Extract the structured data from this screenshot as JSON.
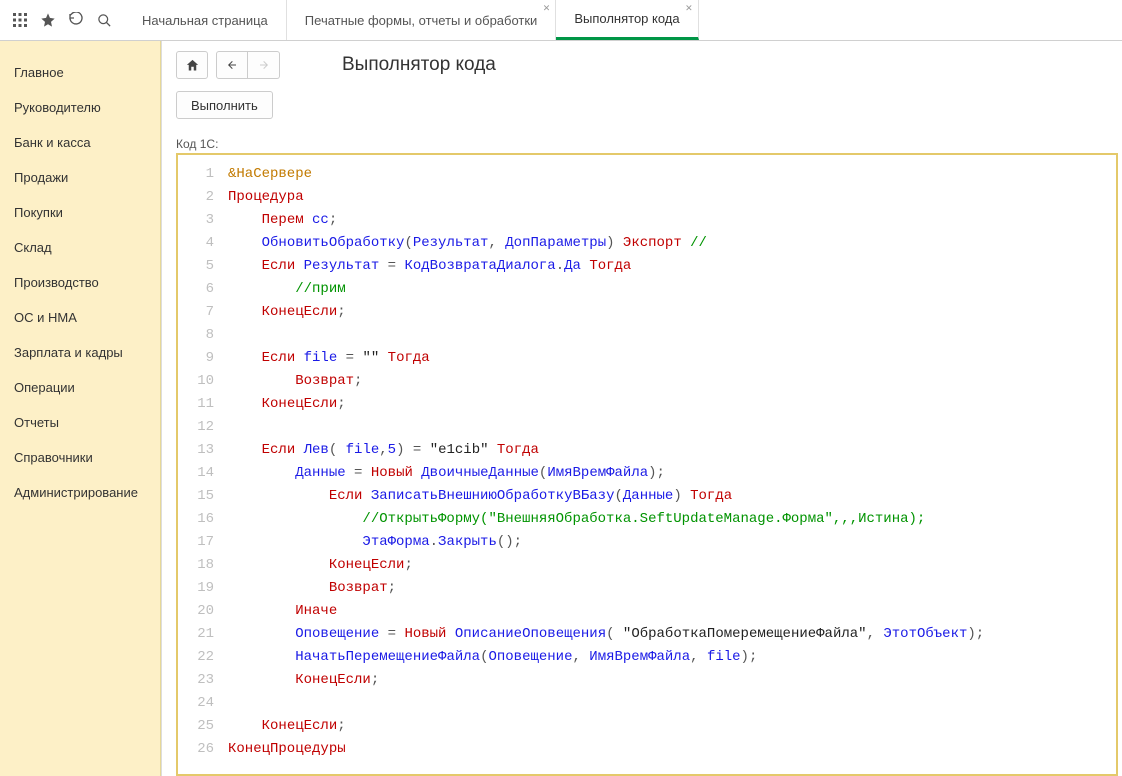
{
  "tabs": [
    {
      "label": "Начальная страница",
      "closable": false,
      "active": false
    },
    {
      "label": "Печатные формы, отчеты и обработки",
      "closable": true,
      "active": false
    },
    {
      "label": "Выполнятор кода",
      "closable": true,
      "active": true
    }
  ],
  "sidebar": {
    "items": [
      "Главное",
      "Руководителю",
      "Банк и касса",
      "Продажи",
      "Покупки",
      "Склад",
      "Производство",
      "ОС и НМА",
      "Зарплата и кадры",
      "Операции",
      "Отчеты",
      "Справочники",
      "Администрирование"
    ]
  },
  "page": {
    "title": "Выполнятор кода",
    "execute_button": "Выполнить",
    "code_label": "Код 1С:"
  },
  "code_lines": [
    [
      {
        "c": "dir",
        "t": "&НаСервере"
      }
    ],
    [
      {
        "c": "kw",
        "t": "Процедура"
      }
    ],
    [
      {
        "c": "pn",
        "t": "    "
      },
      {
        "c": "kw",
        "t": "Перем"
      },
      {
        "c": "pn",
        "t": " "
      },
      {
        "c": "id",
        "t": "сс"
      },
      {
        "c": "pn",
        "t": ";"
      }
    ],
    [
      {
        "c": "pn",
        "t": "    "
      },
      {
        "c": "id",
        "t": "ОбновитьОбработку"
      },
      {
        "c": "pn",
        "t": "("
      },
      {
        "c": "id",
        "t": "Результат"
      },
      {
        "c": "pn",
        "t": ", "
      },
      {
        "c": "id",
        "t": "ДопПараметры"
      },
      {
        "c": "pn",
        "t": ") "
      },
      {
        "c": "kw",
        "t": "Экспорт"
      },
      {
        "c": "pn",
        "t": " "
      },
      {
        "c": "cm",
        "t": "//"
      }
    ],
    [
      {
        "c": "pn",
        "t": "    "
      },
      {
        "c": "kw",
        "t": "Если"
      },
      {
        "c": "pn",
        "t": " "
      },
      {
        "c": "id",
        "t": "Результат"
      },
      {
        "c": "pn",
        "t": " = "
      },
      {
        "c": "id",
        "t": "КодВозвратаДиалога"
      },
      {
        "c": "pn",
        "t": "."
      },
      {
        "c": "id",
        "t": "Да"
      },
      {
        "c": "pn",
        "t": " "
      },
      {
        "c": "kw",
        "t": "Тогда"
      }
    ],
    [
      {
        "c": "pn",
        "t": "        "
      },
      {
        "c": "cm",
        "t": "//прим"
      }
    ],
    [
      {
        "c": "pn",
        "t": "    "
      },
      {
        "c": "kw",
        "t": "КонецЕсли"
      },
      {
        "c": "pn",
        "t": ";"
      }
    ],
    [],
    [
      {
        "c": "pn",
        "t": "    "
      },
      {
        "c": "kw",
        "t": "Если"
      },
      {
        "c": "pn",
        "t": " "
      },
      {
        "c": "id",
        "t": "file"
      },
      {
        "c": "pn",
        "t": " = "
      },
      {
        "c": "str",
        "t": "\"\""
      },
      {
        "c": "pn",
        "t": " "
      },
      {
        "c": "kw",
        "t": "Тогда"
      }
    ],
    [
      {
        "c": "pn",
        "t": "        "
      },
      {
        "c": "kw",
        "t": "Возврат"
      },
      {
        "c": "pn",
        "t": ";"
      }
    ],
    [
      {
        "c": "pn",
        "t": "    "
      },
      {
        "c": "kw",
        "t": "КонецЕсли"
      },
      {
        "c": "pn",
        "t": ";"
      }
    ],
    [],
    [
      {
        "c": "pn",
        "t": "    "
      },
      {
        "c": "kw",
        "t": "Если"
      },
      {
        "c": "pn",
        "t": " "
      },
      {
        "c": "id",
        "t": "Лев"
      },
      {
        "c": "pn",
        "t": "( "
      },
      {
        "c": "id",
        "t": "file"
      },
      {
        "c": "pn",
        "t": ","
      },
      {
        "c": "id",
        "t": "5"
      },
      {
        "c": "pn",
        "t": ") = "
      },
      {
        "c": "str",
        "t": "\"e1cib\""
      },
      {
        "c": "pn",
        "t": " "
      },
      {
        "c": "kw",
        "t": "Тогда"
      }
    ],
    [
      {
        "c": "pn",
        "t": "        "
      },
      {
        "c": "id",
        "t": "Данные"
      },
      {
        "c": "pn",
        "t": " = "
      },
      {
        "c": "kw",
        "t": "Новый"
      },
      {
        "c": "pn",
        "t": " "
      },
      {
        "c": "id",
        "t": "ДвоичныеДанные"
      },
      {
        "c": "pn",
        "t": "("
      },
      {
        "c": "id",
        "t": "ИмяВремФайла"
      },
      {
        "c": "pn",
        "t": ");"
      }
    ],
    [
      {
        "c": "pn",
        "t": "            "
      },
      {
        "c": "kw",
        "t": "Если"
      },
      {
        "c": "pn",
        "t": " "
      },
      {
        "c": "id",
        "t": "ЗаписатьВнешниюОбработкуВБазу"
      },
      {
        "c": "pn",
        "t": "("
      },
      {
        "c": "id",
        "t": "Данные"
      },
      {
        "c": "pn",
        "t": ") "
      },
      {
        "c": "kw",
        "t": "Тогда"
      }
    ],
    [
      {
        "c": "pn",
        "t": "                "
      },
      {
        "c": "cm",
        "t": "//ОткрытьФорму(\"ВнешняяОбработка.SeftUpdateManage.Форма\",,,Истина);"
      }
    ],
    [
      {
        "c": "pn",
        "t": "                "
      },
      {
        "c": "id",
        "t": "ЭтаФорма"
      },
      {
        "c": "pn",
        "t": "."
      },
      {
        "c": "id",
        "t": "Закрыть"
      },
      {
        "c": "pn",
        "t": "();"
      }
    ],
    [
      {
        "c": "pn",
        "t": "            "
      },
      {
        "c": "kw",
        "t": "КонецЕсли"
      },
      {
        "c": "pn",
        "t": ";"
      }
    ],
    [
      {
        "c": "pn",
        "t": "            "
      },
      {
        "c": "kw",
        "t": "Возврат"
      },
      {
        "c": "pn",
        "t": ";"
      }
    ],
    [
      {
        "c": "pn",
        "t": "        "
      },
      {
        "c": "kw",
        "t": "Иначе"
      }
    ],
    [
      {
        "c": "pn",
        "t": "        "
      },
      {
        "c": "id",
        "t": "Оповещение"
      },
      {
        "c": "pn",
        "t": " = "
      },
      {
        "c": "kw",
        "t": "Новый"
      },
      {
        "c": "pn",
        "t": " "
      },
      {
        "c": "id",
        "t": "ОписаниеОповещения"
      },
      {
        "c": "pn",
        "t": "( "
      },
      {
        "c": "str",
        "t": "\"ОбработкаПомеремещениеФайла\""
      },
      {
        "c": "pn",
        "t": ", "
      },
      {
        "c": "id",
        "t": "ЭтотОбъект"
      },
      {
        "c": "pn",
        "t": ");"
      }
    ],
    [
      {
        "c": "pn",
        "t": "        "
      },
      {
        "c": "id",
        "t": "НачатьПеремещениеФайла"
      },
      {
        "c": "pn",
        "t": "("
      },
      {
        "c": "id",
        "t": "Оповещение"
      },
      {
        "c": "pn",
        "t": ", "
      },
      {
        "c": "id",
        "t": "ИмяВремФайла"
      },
      {
        "c": "pn",
        "t": ", "
      },
      {
        "c": "id",
        "t": "file"
      },
      {
        "c": "pn",
        "t": ");"
      }
    ],
    [
      {
        "c": "pn",
        "t": "        "
      },
      {
        "c": "kw",
        "t": "КонецЕсли"
      },
      {
        "c": "pn",
        "t": ";"
      }
    ],
    [],
    [
      {
        "c": "pn",
        "t": "    "
      },
      {
        "c": "kw",
        "t": "КонецЕсли"
      },
      {
        "c": "pn",
        "t": ";"
      }
    ],
    [
      {
        "c": "kw",
        "t": "КонецПроцедуры"
      }
    ]
  ]
}
